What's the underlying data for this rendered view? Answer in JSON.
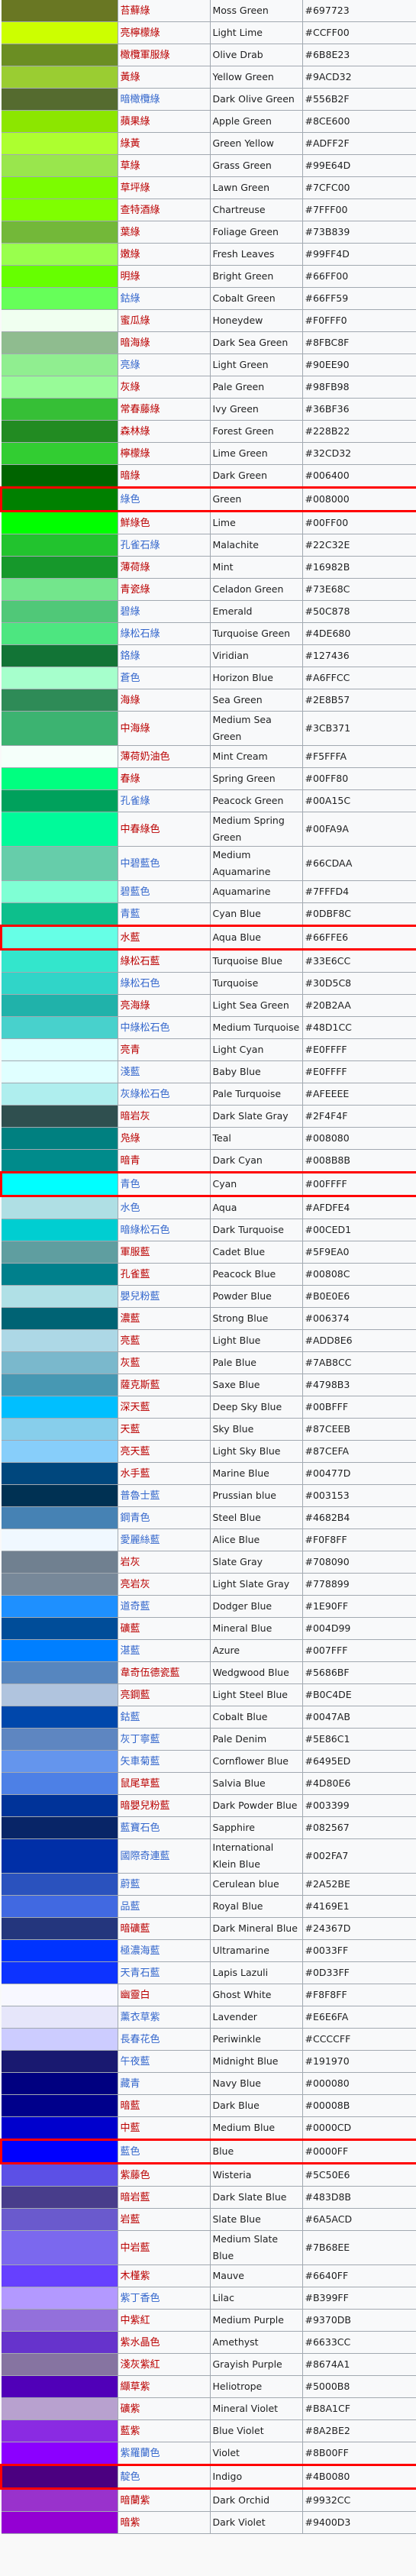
{
  "rows": [
    {
      "zh": "苔蘚綠",
      "link": "new",
      "en": "Moss Green",
      "hex": "#697723"
    },
    {
      "zh": "亮檸檬綠",
      "link": "new",
      "en": "Light Lime",
      "hex": "#CCFF00"
    },
    {
      "zh": "橄欖軍服綠",
      "link": "new",
      "en": "Olive Drab",
      "hex": "#6B8E23"
    },
    {
      "zh": "黃綠",
      "link": "new",
      "en": "Yellow Green",
      "hex": "#9ACD32"
    },
    {
      "zh": "暗橄欖綠",
      "link": "exists",
      "en": "Dark Olive Green",
      "hex": "#556B2F"
    },
    {
      "zh": "蘋果綠",
      "link": "new",
      "en": "Apple Green",
      "hex": "#8CE600"
    },
    {
      "zh": "綠黃",
      "link": "new",
      "en": "Green Yellow",
      "hex": "#ADFF2F"
    },
    {
      "zh": "草綠",
      "link": "new",
      "en": "Grass Green",
      "hex": "#99E64D"
    },
    {
      "zh": "草坪綠",
      "link": "new",
      "en": "Lawn Green",
      "hex": "#7CFC00"
    },
    {
      "zh": "查特酒綠",
      "link": "new",
      "en": "Chartreuse",
      "hex": "#7FFF00"
    },
    {
      "zh": "葉綠",
      "link": "new",
      "en": "Foliage Green",
      "hex": "#73B839"
    },
    {
      "zh": "嫩綠",
      "link": "new",
      "en": "Fresh Leaves",
      "hex": "#99FF4D"
    },
    {
      "zh": "明綠",
      "link": "new",
      "en": "Bright Green",
      "hex": "#66FF00"
    },
    {
      "zh": "鈷綠",
      "link": "exists",
      "en": "Cobalt Green",
      "hex": "#66FF59"
    },
    {
      "zh": "蜜瓜綠",
      "link": "new",
      "en": "Honeydew",
      "hex": "#F0FFF0"
    },
    {
      "zh": "暗海綠",
      "link": "new",
      "en": "Dark Sea Green",
      "hex": "#8FBC8F"
    },
    {
      "zh": "亮綠",
      "link": "exists",
      "en": "Light Green",
      "hex": "#90EE90"
    },
    {
      "zh": "灰綠",
      "link": "new",
      "en": "Pale Green",
      "hex": "#98FB98"
    },
    {
      "zh": "常春藤綠",
      "link": "new",
      "en": "Ivy Green",
      "hex": "#36BF36"
    },
    {
      "zh": "森林綠",
      "link": "new",
      "en": "Forest Green",
      "hex": "#228B22"
    },
    {
      "zh": "檸檬綠",
      "link": "new",
      "en": "Lime Green",
      "hex": "#32CD32"
    },
    {
      "zh": "暗綠",
      "link": "new",
      "en": "Dark Green",
      "hex": "#006400"
    },
    {
      "zh": "綠色",
      "link": "exists",
      "en": "Green",
      "hex": "#008000",
      "highlight": true
    },
    {
      "zh": "鮮綠色",
      "link": "new",
      "en": "Lime",
      "hex": "#00FF00"
    },
    {
      "zh": "孔雀石綠",
      "link": "exists",
      "en": "Malachite",
      "hex": "#22C32E"
    },
    {
      "zh": "薄荷綠",
      "link": "new",
      "en": "Mint",
      "hex": "#16982B"
    },
    {
      "zh": "青瓷綠",
      "link": "new",
      "en": "Celadon Green",
      "hex": "#73E68C"
    },
    {
      "zh": "碧綠",
      "link": "exists",
      "en": "Emerald",
      "hex": "#50C878"
    },
    {
      "zh": "綠松石綠",
      "link": "exists",
      "en": "Turquoise Green",
      "hex": "#4DE680"
    },
    {
      "zh": "鉻綠",
      "link": "exists",
      "en": "Viridian",
      "hex": "#127436"
    },
    {
      "zh": "蒼色",
      "link": "exists",
      "en": "Horizon Blue",
      "hex": "#A6FFCC"
    },
    {
      "zh": "海綠",
      "link": "new",
      "en": "Sea Green",
      "hex": "#2E8B57"
    },
    {
      "zh": "中海綠",
      "link": "new",
      "en": "Medium Sea Green",
      "hex": "#3CB371"
    },
    {
      "zh": "薄荷奶油色",
      "link": "new",
      "en": "Mint Cream",
      "hex": "#F5FFFA"
    },
    {
      "zh": "春綠",
      "link": "new",
      "en": "Spring Green",
      "hex": "#00FF80"
    },
    {
      "zh": "孔雀綠",
      "link": "exists",
      "en": "Peacock Green",
      "hex": "#00A15C"
    },
    {
      "zh": "中春綠色",
      "link": "new",
      "en": "Medium Spring Green",
      "hex": "#00FA9A"
    },
    {
      "zh": "中碧藍色",
      "link": "exists",
      "en": "Medium Aquamarine",
      "hex": "#66CDAA"
    },
    {
      "zh": "碧藍色",
      "link": "exists",
      "en": "Aquamarine",
      "hex": "#7FFFD4"
    },
    {
      "zh": "青藍",
      "link": "exists",
      "en": "Cyan Blue",
      "hex": "#0DBF8C"
    },
    {
      "zh": "水藍",
      "link": "new",
      "en": "Aqua Blue",
      "hex": "#66FFE6",
      "highlight": true
    },
    {
      "zh": "綠松石藍",
      "link": "new",
      "en": "Turquoise Blue",
      "hex": "#33E6CC"
    },
    {
      "zh": "綠松石色",
      "link": "exists",
      "en": "Turquoise",
      "hex": "#30D5C8"
    },
    {
      "zh": "亮海綠",
      "link": "new",
      "en": "Light Sea Green",
      "hex": "#20B2AA"
    },
    {
      "zh": "中綠松石色",
      "link": "exists",
      "en": "Medium Turquoise",
      "hex": "#48D1CC"
    },
    {
      "zh": "亮青",
      "link": "new",
      "en": "Light Cyan",
      "hex": "#E0FFFF"
    },
    {
      "zh": "淺藍",
      "link": "exists",
      "en": "Baby Blue",
      "hex": "#E0FFFF"
    },
    {
      "zh": "灰綠松石色",
      "link": "exists",
      "en": "Pale Turquoise",
      "hex": "#AFEEEE"
    },
    {
      "zh": "暗岩灰",
      "link": "new",
      "en": "Dark Slate Gray",
      "hex": "#2F4F4F"
    },
    {
      "zh": "凫綠",
      "link": "new",
      "en": "Teal",
      "hex": "#008080"
    },
    {
      "zh": "暗青",
      "link": "new",
      "en": "Dark Cyan",
      "hex": "#008B8B"
    },
    {
      "zh": "青色",
      "link": "exists",
      "en": "Cyan",
      "hex": "#00FFFF",
      "highlight": true
    },
    {
      "zh": "水色",
      "link": "exists",
      "en": "Aqua",
      "hex": "#AFDFE4"
    },
    {
      "zh": "暗綠松石色",
      "link": "exists",
      "en": "Dark Turquoise",
      "hex": "#00CED1"
    },
    {
      "zh": "軍服藍",
      "link": "new",
      "en": "Cadet Blue",
      "hex": "#5F9EA0"
    },
    {
      "zh": "孔雀藍",
      "link": "new",
      "en": "Peacock Blue",
      "hex": "#00808C"
    },
    {
      "zh": "嬰兒粉藍",
      "link": "exists",
      "en": "Powder Blue",
      "hex": "#B0E0E6"
    },
    {
      "zh": "濃藍",
      "link": "new",
      "en": "Strong Blue",
      "hex": "#006374"
    },
    {
      "zh": "亮藍",
      "link": "new",
      "en": "Light Blue",
      "hex": "#ADD8E6"
    },
    {
      "zh": "灰藍",
      "link": "new",
      "en": "Pale Blue",
      "hex": "#7AB8CC"
    },
    {
      "zh": "薩克斯藍",
      "link": "new",
      "en": "Saxe Blue",
      "hex": "#4798B3"
    },
    {
      "zh": "深天藍",
      "link": "new",
      "en": "Deep Sky Blue",
      "hex": "#00BFFF"
    },
    {
      "zh": "天藍",
      "link": "new",
      "en": "Sky Blue",
      "hex": "#87CEEB"
    },
    {
      "zh": "亮天藍",
      "link": "new",
      "en": "Light Sky Blue",
      "hex": "#87CEFA"
    },
    {
      "zh": "水手藍",
      "link": "new",
      "en": "Marine Blue",
      "hex": "#00477D"
    },
    {
      "zh": "普魯士藍",
      "link": "exists",
      "en": "Prussian blue",
      "hex": "#003153"
    },
    {
      "zh": "鋼青色",
      "link": "exists",
      "en": "Steel Blue",
      "hex": "#4682B4"
    },
    {
      "zh": "愛麗絲藍",
      "link": "exists",
      "en": "Alice Blue",
      "hex": "#F0F8FF"
    },
    {
      "zh": "岩灰",
      "link": "new",
      "en": "Slate Gray",
      "hex": "#708090"
    },
    {
      "zh": "亮岩灰",
      "link": "new",
      "en": "Light Slate Gray",
      "hex": "#778899"
    },
    {
      "zh": "道奇藍",
      "link": "exists",
      "en": "Dodger Blue",
      "hex": "#1E90FF"
    },
    {
      "zh": "礦藍",
      "link": "new",
      "en": "Mineral Blue",
      "hex": "#004D99"
    },
    {
      "zh": "湛藍",
      "link": "exists",
      "en": "Azure",
      "hex": "#007FFF"
    },
    {
      "zh": "韋奇伍德瓷藍",
      "link": "new",
      "en": "Wedgwood Blue",
      "hex": "#5686BF"
    },
    {
      "zh": "亮鋼藍",
      "link": "new",
      "en": "Light Steel Blue",
      "hex": "#B0C4DE"
    },
    {
      "zh": "鈷藍",
      "link": "exists",
      "en": "Cobalt Blue",
      "hex": "#0047AB"
    },
    {
      "zh": "灰丁寧藍",
      "link": "exists",
      "en": "Pale Denim",
      "hex": "#5E86C1"
    },
    {
      "zh": "矢車菊藍",
      "link": "exists",
      "en": "Cornflower Blue",
      "hex": "#6495ED"
    },
    {
      "zh": "鼠尾草藍",
      "link": "new",
      "en": "Salvia Blue",
      "hex": "#4D80E6"
    },
    {
      "zh": "暗嬰兒粉藍",
      "link": "new",
      "en": "Dark Powder Blue",
      "hex": "#003399"
    },
    {
      "zh": "藍寶石色",
      "link": "exists",
      "en": "Sapphire",
      "hex": "#082567"
    },
    {
      "zh": "國際奇連藍",
      "link": "exists",
      "en": "International Klein Blue",
      "hex": "#002FA7"
    },
    {
      "zh": "蔚藍",
      "link": "exists",
      "en": "Cerulean blue",
      "hex": "#2A52BE"
    },
    {
      "zh": "品藍",
      "link": "exists",
      "en": "Royal Blue",
      "hex": "#4169E1"
    },
    {
      "zh": "暗礦藍",
      "link": "new",
      "en": "Dark Mineral Blue",
      "hex": "#24367D"
    },
    {
      "zh": "極濃海藍",
      "link": "exists",
      "en": "Ultramarine",
      "hex": "#0033FF"
    },
    {
      "zh": "天青石藍",
      "link": "exists",
      "en": "Lapis Lazuli",
      "hex": "#0D33FF"
    },
    {
      "zh": "幽靈白",
      "link": "new",
      "en": "Ghost White",
      "hex": "#F8F8FF"
    },
    {
      "zh": "薰衣草紫",
      "link": "exists",
      "en": "Lavender",
      "hex": "#E6E6FA"
    },
    {
      "zh": "長春花色",
      "link": "exists",
      "en": "Periwinkle",
      "hex": "#CCCCFF"
    },
    {
      "zh": "午夜藍",
      "link": "exists",
      "en": "Midnight Blue",
      "hex": "#191970"
    },
    {
      "zh": "藏青",
      "link": "exists",
      "en": "Navy Blue",
      "hex": "#000080"
    },
    {
      "zh": "暗藍",
      "link": "new",
      "en": "Dark Blue",
      "hex": "#00008B"
    },
    {
      "zh": "中藍",
      "link": "new",
      "en": "Medium Blue",
      "hex": "#0000CD"
    },
    {
      "zh": "藍色",
      "link": "exists",
      "en": "Blue",
      "hex": "#0000FF",
      "highlight": true
    },
    {
      "zh": "紫藤色",
      "link": "new",
      "en": "Wisteria",
      "hex": "#5C50E6"
    },
    {
      "zh": "暗岩藍",
      "link": "new",
      "en": "Dark Slate Blue",
      "hex": "#483D8B"
    },
    {
      "zh": "岩藍",
      "link": "new",
      "en": "Slate Blue",
      "hex": "#6A5ACD"
    },
    {
      "zh": "中岩藍",
      "link": "new",
      "en": "Medium Slate Blue",
      "hex": "#7B68EE"
    },
    {
      "zh": "木槿紫",
      "link": "new",
      "en": "Mauve",
      "hex": "#6640FF"
    },
    {
      "zh": "紫丁香色",
      "link": "exists",
      "en": "Lilac",
      "hex": "#B399FF"
    },
    {
      "zh": "中紫紅",
      "link": "new",
      "en": "Medium Purple",
      "hex": "#9370DB"
    },
    {
      "zh": "紫水晶色",
      "link": "new",
      "en": "Amethyst",
      "hex": "#6633CC"
    },
    {
      "zh": "淺灰紫紅",
      "link": "new",
      "en": "Grayish Purple",
      "hex": "#8674A1"
    },
    {
      "zh": "纈草紫",
      "link": "new",
      "en": "Heliotrope",
      "hex": "#5000B8"
    },
    {
      "zh": "礦紫",
      "link": "new",
      "en": "Mineral Violet",
      "hex": "#B8A1CF"
    },
    {
      "zh": "藍紫",
      "link": "new",
      "en": "Blue Violet",
      "hex": "#8A2BE2"
    },
    {
      "zh": "紫羅蘭色",
      "link": "exists",
      "en": "Violet",
      "hex": "#8B00FF"
    },
    {
      "zh": "靛色",
      "link": "exists",
      "en": "Indigo",
      "hex": "#4B0080",
      "highlight": true
    },
    {
      "zh": "暗蘭紫",
      "link": "new",
      "en": "Dark Orchid",
      "hex": "#9932CC"
    },
    {
      "zh": "暗紫",
      "link": "new",
      "en": "Dark Violet",
      "hex": "#9400D3"
    }
  ]
}
